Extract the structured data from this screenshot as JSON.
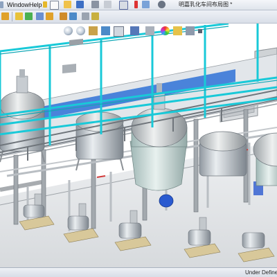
{
  "menu": {
    "window_label": "Window",
    "help_label": "Help"
  },
  "document_title": "明嘉乳化车间布局图 *",
  "status": {
    "units": "Under Defined"
  },
  "toolbar_icons": [
    "sketch-icon",
    "component-icon",
    "rebuild-icon",
    "options-icon",
    "new-document-icon",
    "open-icon",
    "save-icon",
    "print-icon",
    "undo-icon",
    "select-icon",
    "rebuild-traffic-light-icon",
    "file-properties-icon",
    "options-gear-icon"
  ],
  "headsup_icons": [
    "zoom-to-fit-icon",
    "zoom-to-area-icon",
    "previous-view-icon",
    "section-view-icon",
    "view-orientation-icon",
    "display-style-icon",
    "hide-show-items-icon",
    "edit-appearance-icon",
    "apply-scene-icon",
    "view-settings-icon"
  ],
  "colors": {
    "cyan_frame": "#19c9d8",
    "gray_structure": "#8c9094",
    "steel": "#b8bfc6",
    "floor_blue": "#3a78d8",
    "motor_blue": "#2a5ad0",
    "pallet": "#d8c89a"
  }
}
